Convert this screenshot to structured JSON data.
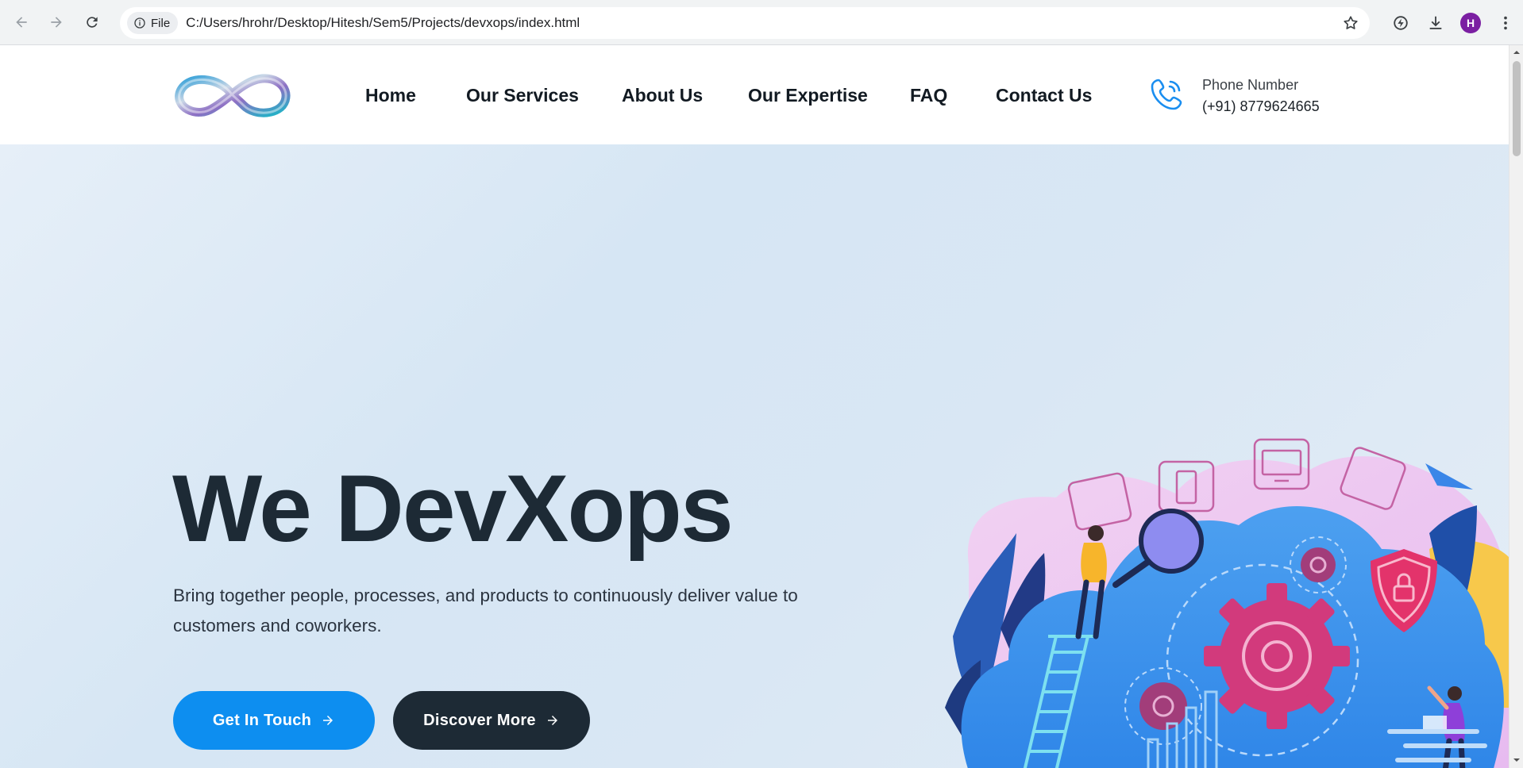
{
  "browser": {
    "file_chip_label": "File",
    "url": "C:/Users/hrohr/Desktop/Hitesh/Sem5/Projects/devxops/index.html",
    "profile_initial": "H"
  },
  "header": {
    "nav": [
      "Home",
      "Our Services",
      "About Us",
      "Our Expertise",
      "FAQ",
      "Contact Us"
    ],
    "phone_label": "Phone Number",
    "phone_number": "(+91) 8779624665"
  },
  "hero": {
    "title": "We DevXops",
    "subtitle": "Bring together people, processes, and products to continuously deliver value to customers and coworkers.",
    "primary_button": "Get In Touch",
    "secondary_button": "Discover More"
  },
  "colors": {
    "primary": "#0d8ef0",
    "dark": "#1d2a35",
    "hero_bg": "#d9e7f4"
  },
  "icons": [
    "back-arrow-icon",
    "forward-arrow-icon",
    "reload-icon",
    "info-icon",
    "star-icon",
    "performance-icon",
    "download-icon",
    "menu-dots-icon",
    "phone-icon",
    "arrow-right-icon"
  ]
}
